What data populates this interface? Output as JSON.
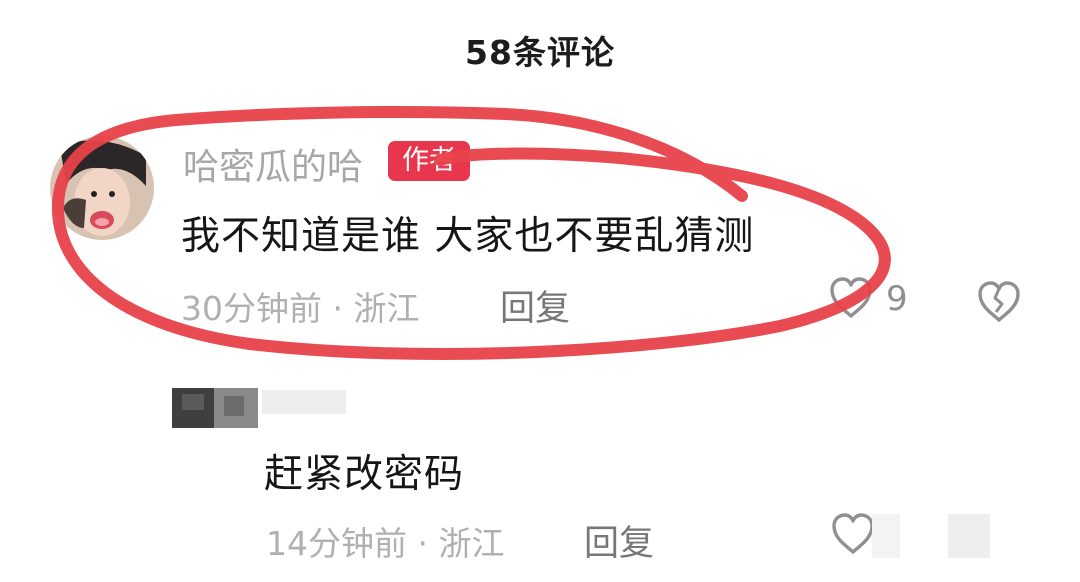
{
  "header": {
    "title": "58条评论"
  },
  "comments": [
    {
      "username": "哈密瓜的哈",
      "badge": "作者",
      "text": "我不知道是谁 大家也不要乱猜测",
      "meta": "30分钟前 · 浙江",
      "reply_label": "回复",
      "likes": "9"
    },
    {
      "username": "",
      "text": "赶紧改密码",
      "meta": "14分钟前 · 浙江",
      "reply_label": "回复",
      "likes": ""
    }
  ],
  "colors": {
    "badge": "#e8374d",
    "annotation_circle": "#e8414a",
    "meta_text": "#b0b0b0"
  },
  "icons": {
    "like": "heart-outline-icon",
    "dislike": "broken-heart-icon"
  }
}
